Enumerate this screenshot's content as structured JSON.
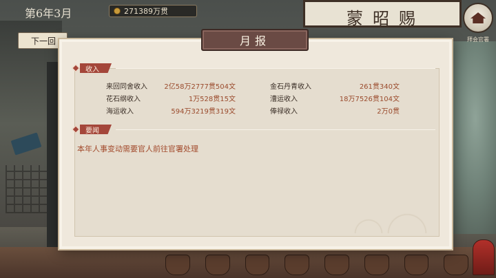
{
  "hud": {
    "date": "第6年3月",
    "money": "271389万贯",
    "next_button": "下一回",
    "avatar_caption": "拜会官署"
  },
  "background": {
    "sign_text": "蒙昭赐"
  },
  "modal": {
    "title": "月报",
    "income_header": "收入",
    "news_header": "要闻",
    "income": [
      {
        "label": "来回同舍收入",
        "value": "2亿58万2777贯504文"
      },
      {
        "label": "金石丹青收入",
        "value": "261贯340文"
      },
      {
        "label": "花石纲收入",
        "value": "1万528贯15文"
      },
      {
        "label": "漕运收入",
        "value": "18万7526贯104文"
      },
      {
        "label": "海运收入",
        "value": "594万3219贯319文"
      },
      {
        "label": "俸禄收入",
        "value": "2万0贯"
      }
    ],
    "news": [
      "本年人事变动需要官人前往官署处理"
    ]
  },
  "colors": {
    "accent_red": "#a4463a",
    "value_orange": "#9a4a2c",
    "title_plate": "#6a4a44",
    "panel_bg": "#efe8dc"
  }
}
